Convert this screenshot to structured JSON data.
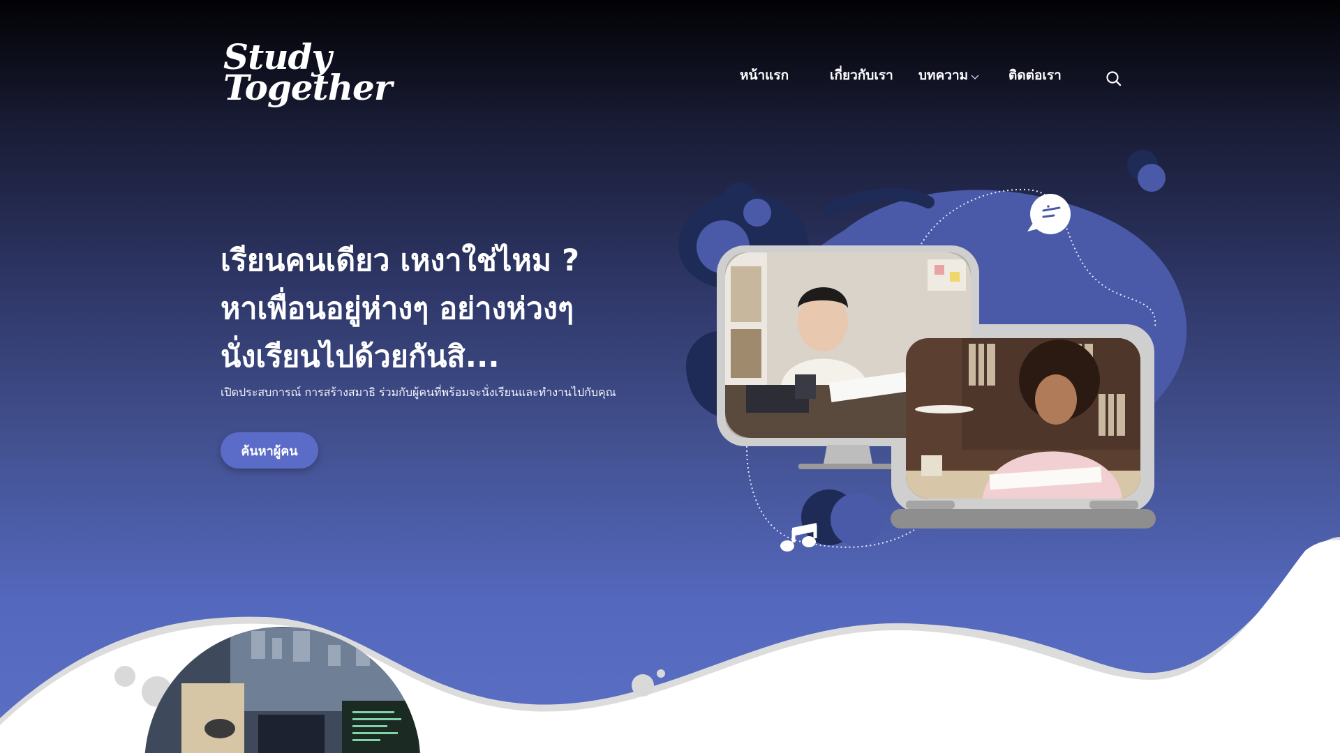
{
  "brand": {
    "line1": "Study",
    "line2": "Together"
  },
  "nav": {
    "items": [
      {
        "label": "หน้าแรก"
      },
      {
        "label": "เกี่ยวกับเรา"
      },
      {
        "label": "บทความ"
      },
      {
        "label": "ติดต่อเรา"
      }
    ],
    "search_icon": "search-icon"
  },
  "hero": {
    "title_line1": "เรียนคนเดียว เหงาใช่ไหม ?",
    "title_line2": "หาเพื่อนอยู่ห่างๆ อย่างห่วงๆ",
    "title_line3": "นั่งเรียนไปด้วยกันสิ...",
    "subtitle": "เปิดประสบการณ์ การสร้างสมาธิ ร่วมกับผู้คนที่พร้อมจะนั่งเรียนและทำงานไปกับคุณ",
    "cta_label": "ค้นหาผู้คน"
  },
  "colors": {
    "accent": "#5b6cc8",
    "blob": "#4a5aa8",
    "blob_dark": "#1f2b57",
    "device_frame": "#cfcfcf",
    "white": "#ffffff"
  },
  "icons": [
    "search-icon",
    "chevron-down-icon",
    "chat-bubble-icon",
    "music-note-icon"
  ]
}
